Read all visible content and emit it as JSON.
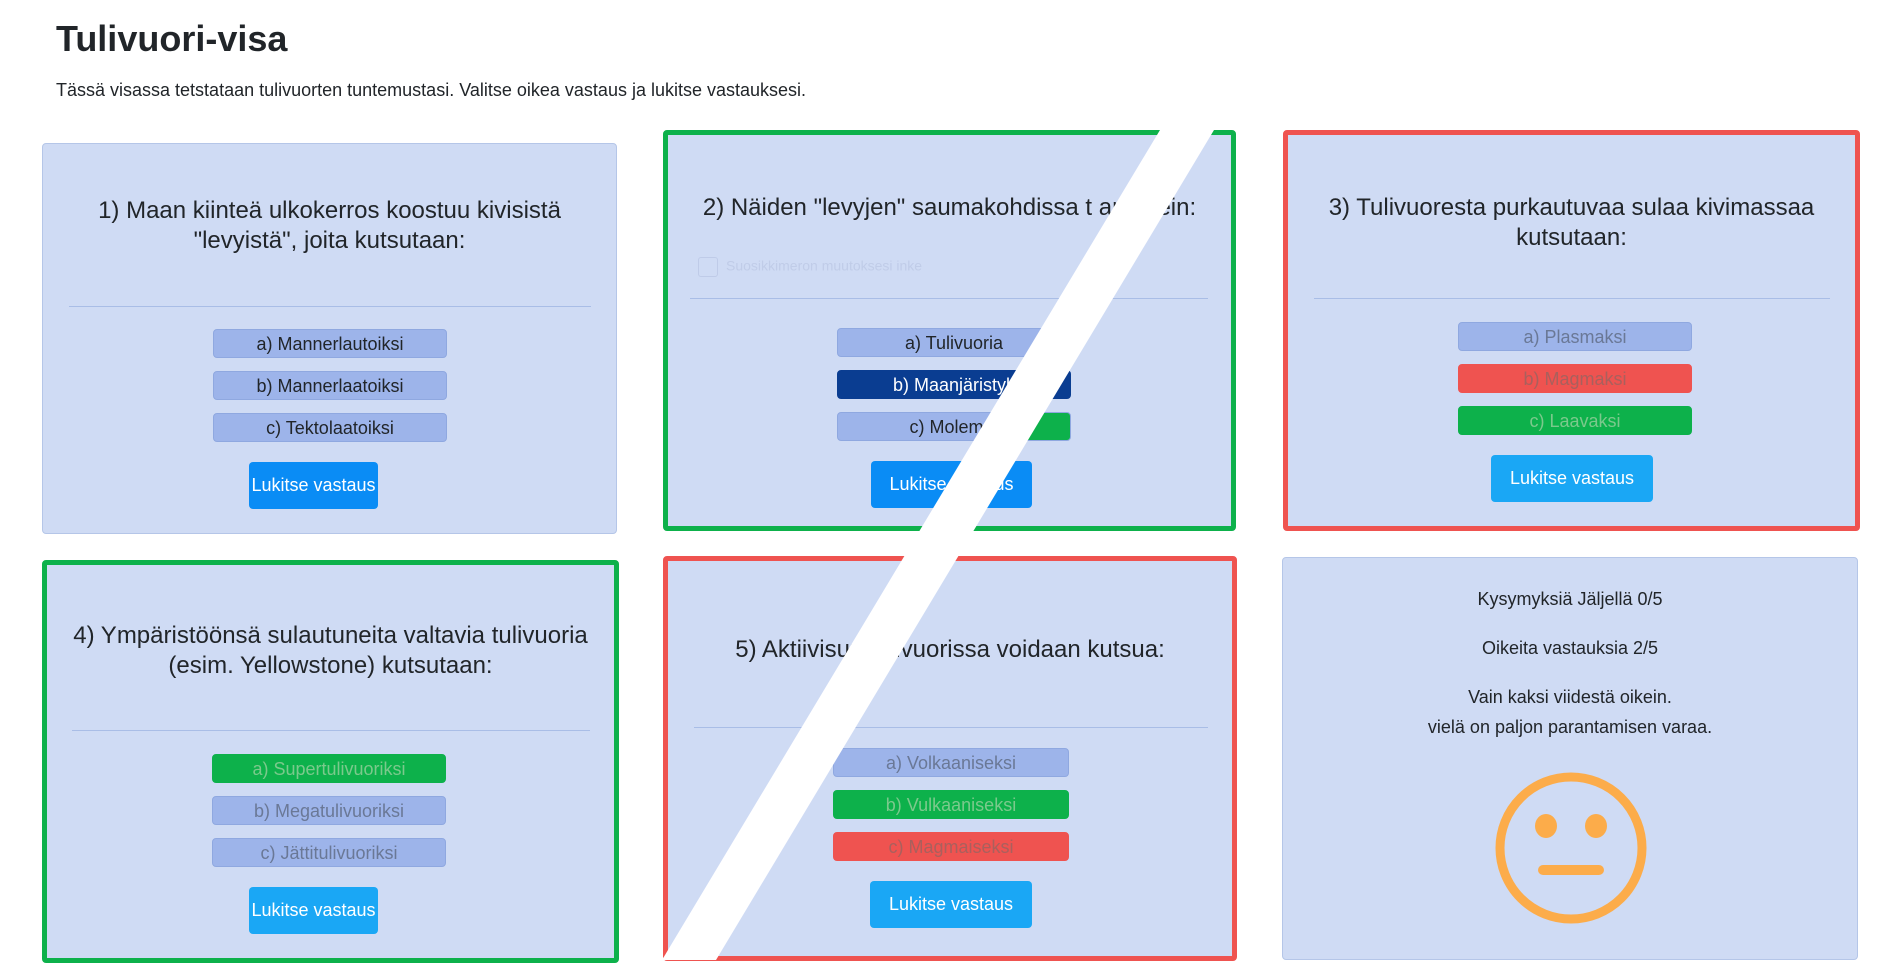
{
  "page": {
    "title": "Tulivuori-visa",
    "subtitle": "Tässä visassa tetstataan tulivuorten tuntemustasi. Valitse oikea vastaus ja lukitse vastauksesi."
  },
  "lock_label": "Lukitse vastaus",
  "questions": [
    {
      "text": "1) Maan kiinteä ulkokerros koostuu kivisistä \"levyistä\", joita kutsutaan:",
      "options": [
        "a) Mannerlautoiksi",
        "b) Mannerlaatoiksi",
        "c) Tektolaatoiksi"
      ]
    },
    {
      "text": "2) Näiden \"levyjen\" saumakohdissa t     an usein:",
      "ghost": "Suosikkimeron muutoksesi inke",
      "options": [
        "a) Tulivuoria",
        "b) Maanjäristyk",
        "c) Molemm"
      ]
    },
    {
      "text": "3) Tulivuoresta purkautuvaa sulaa kivimassaa kutsutaan:",
      "options": [
        "a) Plasmaksi",
        "b) Magmaksi",
        "c) Laavaksi"
      ]
    },
    {
      "text": "4) Ympäristöönsä sulautuneita valtavia tulivuoria (esim. Yellowstone) kutsutaan:",
      "options": [
        "a) Supertulivuoriksi",
        "b) Megatulivuoriksi",
        "c) Jättitulivuoriksi"
      ]
    },
    {
      "text": "5) Aktiivisuut    ulivuorissa voidaan kutsua:",
      "options": [
        "a) Volkaaniseksi",
        "b) Vulkaaniseksi",
        "c) Magmaiseksi"
      ]
    }
  ],
  "results": {
    "remaining": "Kysymyksiä Jäljellä 0/5",
    "correct": "Oikeita vastauksia 2/5",
    "feedback_line1": "Vain kaksi viidestä oikein.",
    "feedback_line2": "vielä on paljon parantamisen varaa.",
    "face_icon": "neutral-face-icon",
    "face_color": "#fcac4a"
  },
  "colors": {
    "correct_border": "#0db14b",
    "wrong_border": "#ef5350",
    "lock_button": "#0a8cf5",
    "card_bg": "#cfdbf4"
  }
}
